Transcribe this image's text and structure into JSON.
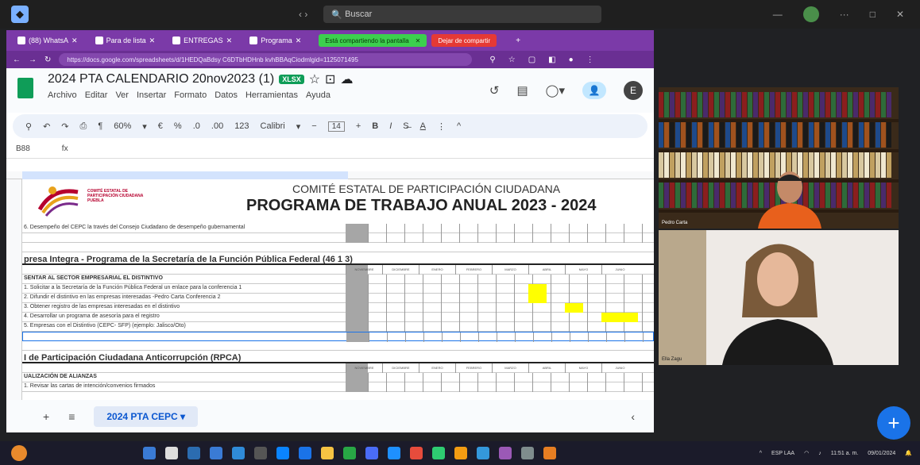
{
  "topbar": {
    "search": "Buscar",
    "nav": "‹   ›"
  },
  "browser": {
    "tabs": [
      {
        "label": "(88) WhatsA"
      },
      {
        "label": "Para de lista"
      },
      {
        "label": "ENTREGAS"
      },
      {
        "label": "Programa"
      }
    ],
    "sharing": "Está compartiendo la pantalla",
    "stop_sharing": "Dejar de compartir",
    "url": "https://docs.google.com/spreadsheets/d/1HEDQaBdsy C6DTbHDHnb kvhBBAqCiodmlgid=1125071495"
  },
  "sheets": {
    "title": "2024 PTA CALENDARIO 20nov2023 (1)",
    "badge": "XLSX",
    "menus": [
      "Archivo",
      "Editar",
      "Ver",
      "Insertar",
      "Formato",
      "Datos",
      "Herramientas",
      "Ayuda"
    ],
    "user_initial": "E",
    "toolbar": {
      "zoom": "60%",
      "currency": "€",
      "percent": "%",
      "font": "Calibri",
      "font_size": "14"
    },
    "cell_ref": "B88",
    "fx": "fx",
    "banner": {
      "org": "COMITÉ ESTATAL DE PARTICIPACIÓN CIUDADANA PUEBLA",
      "title": "COMITÉ ESTATAL DE PARTICIPACIÓN CIUDADANA",
      "subtitle": "PROGRAMA DE TRABAJO ANUAL 2023 - 2024"
    },
    "months": [
      "NOVIEMBRE",
      "DICIEMBRE",
      "ENERO",
      "FEBRERO",
      "MARZO",
      "ABRIL",
      "MAYO",
      "JUNIO"
    ],
    "rows": [
      {
        "text": "6. Desempeño del CEPC la través del Consejo Ciudadano de desempeño gubernamental",
        "type": "normal"
      },
      {
        "text": "",
        "type": "normal"
      },
      {
        "text": "",
        "type": "blank"
      },
      {
        "text": "presa Integra - Programa de la Secretaría de la Función Pública Federal (46 1 3)",
        "type": "section"
      },
      {
        "text": "",
        "type": "months"
      },
      {
        "text": "SENTAR AL SECTOR EMPRESARIAL EL DISTINTIVO",
        "type": "bold"
      },
      {
        "text": "1. Solicitar a la Secretaría de la Función Pública Federal un enlace para la conferencia 1",
        "type": "normal",
        "hl": [
          [
            5,
            1
          ]
        ]
      },
      {
        "text": "2. Difundir el distintivo en las empresas interesadas -Pedro Carta Conferencia 2",
        "type": "normal",
        "hl": [
          [
            5,
            1
          ]
        ]
      },
      {
        "text": "3. Obtener registro de las empresas interesadas en el distintivo",
        "type": "normal",
        "hl": [
          [
            6,
            1
          ]
        ]
      },
      {
        "text": "4. Desarrollar un programa de asesoría para el registro",
        "type": "normal",
        "hl": [
          [
            7,
            2
          ]
        ]
      },
      {
        "text": "5. Empresas con el Distintivo (CEPC- SFP) (ejemplo: Jalisco/Oto)",
        "type": "normal"
      },
      {
        "text": "",
        "type": "selected"
      },
      {
        "text": "",
        "type": "blank"
      },
      {
        "text": "I de Participación Ciudadana Anticorrupción (RPCA)",
        "type": "section"
      },
      {
        "text": "",
        "type": "months"
      },
      {
        "text": "UALIZACIÓN DE ALIANZAS",
        "type": "bold"
      },
      {
        "text": "1. Revisar las cartas de intención/convenios firmados",
        "type": "normal"
      }
    ],
    "sheet_tab": "2024 PTA CEPC ▾",
    "add_sheet": "+",
    "all_sheets": "≡"
  },
  "video": {
    "p1_label": "Pedro Carta",
    "p2_label": "Ella Zagu"
  },
  "taskbar": {
    "lang": "ESP LAA",
    "time": "11:51 a. m.",
    "date": "09/01/2024"
  },
  "colors": {
    "browser_purple": "#7b3aa8",
    "highlight": "#ffff00",
    "sheets_green": "#0f9d58"
  }
}
